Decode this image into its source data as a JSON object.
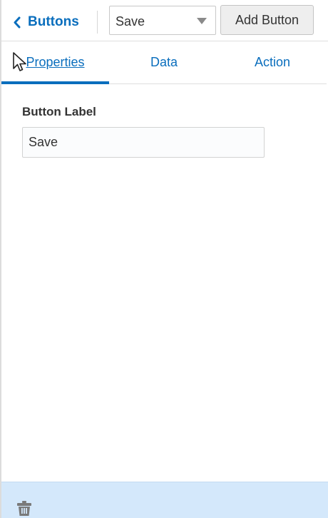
{
  "header": {
    "back_label": "Buttons",
    "select": {
      "value": "Save"
    },
    "add_button_label": "Add Button"
  },
  "tabs": [
    {
      "label": "Properties",
      "active": true
    },
    {
      "label": "Data",
      "active": false
    },
    {
      "label": "Action",
      "active": false
    }
  ],
  "form": {
    "button_label": {
      "label": "Button Label",
      "value": "Save"
    }
  },
  "colors": {
    "accent": "#0a6ebd",
    "footer_bg": "#d4e8fb",
    "icon_gray": "#7a7a7a"
  },
  "icons": {
    "back": "chevron-left-icon",
    "select_caret": "caret-down-icon",
    "cursor": "mouse-pointer-icon",
    "footer_action": "trash-icon"
  }
}
